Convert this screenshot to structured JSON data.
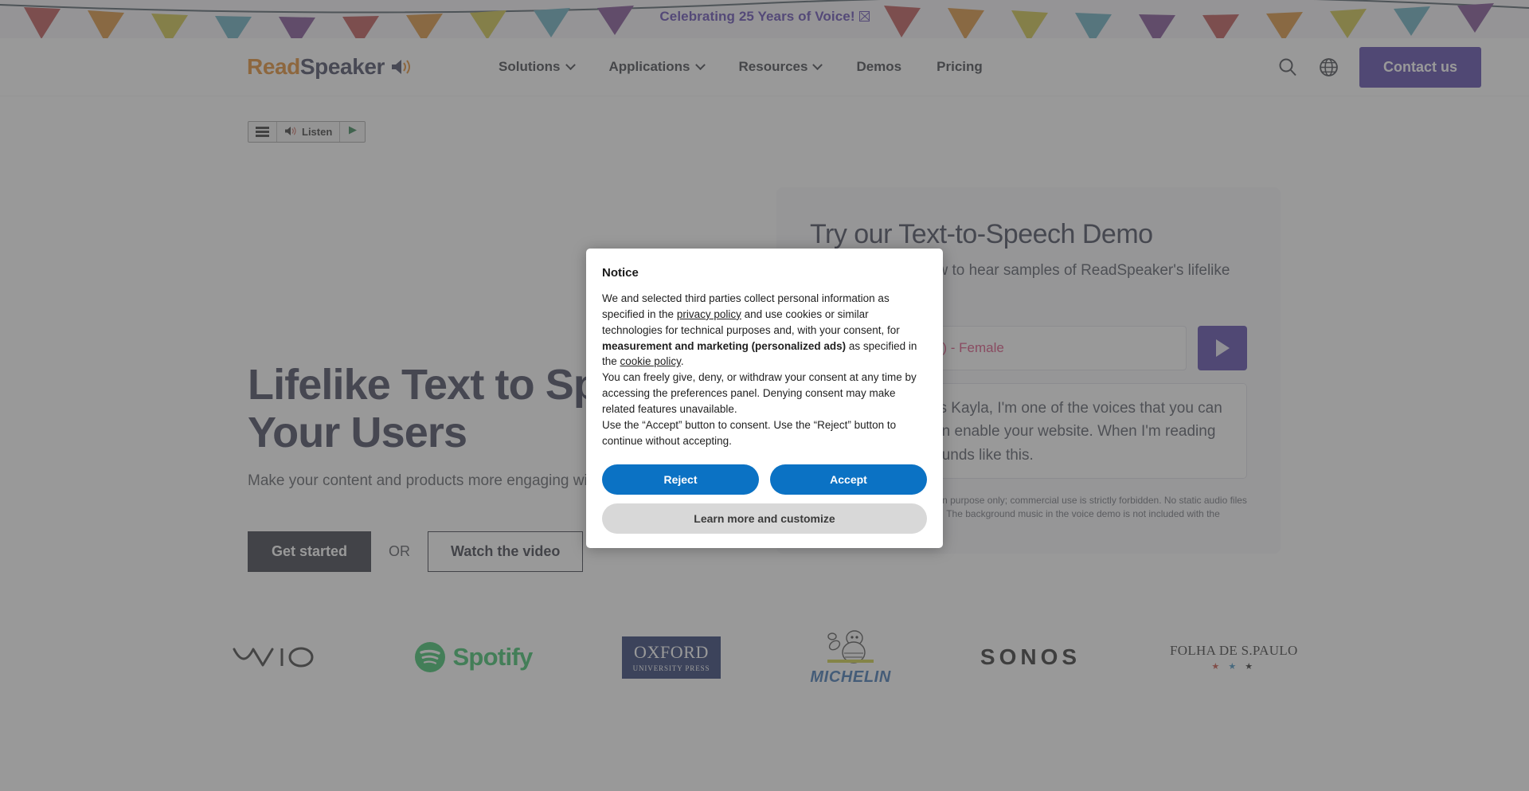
{
  "banner": {
    "text": "Celebrating 25 Years of Voice!",
    "glyph": "tofu-box-glyph"
  },
  "header": {
    "logo": {
      "part1": "Read",
      "part2": "Speaker",
      "icon": "speaker-volume-icon"
    },
    "nav": [
      {
        "label": "Solutions",
        "has_chevron": true
      },
      {
        "label": "Applications",
        "has_chevron": true
      },
      {
        "label": "Resources",
        "has_chevron": true
      },
      {
        "label": "Demos",
        "has_chevron": false
      },
      {
        "label": "Pricing",
        "has_chevron": false
      }
    ],
    "search_icon": "search-icon",
    "language_icon": "globe-icon",
    "contact_label": "Contact us",
    "accent_color": "#3f2a9e"
  },
  "listen_widget": {
    "menu_icon": "hamburger-menu-icon",
    "listen_label": "Listen",
    "speaker_icon": "speaker-icon",
    "play_icon": "play-triangle-icon"
  },
  "hero": {
    "title": "Lifelike Text to Speech for Your Users",
    "subtitle": "Make your content and products more engaging with our text to speech solutions",
    "primary_cta": "Get started",
    "or_label": "OR",
    "secondary_cta": "Watch the video"
  },
  "demo": {
    "title": "Try our Text-to-Speech Demo",
    "subtitle": "Select a voice below to hear samples of ReadSpeaker's lifelike voices",
    "voice_selected": "Kayla - English (US) - Female",
    "play_icon": "play-triangle-icon",
    "sample_text": "Hello! My name is Kayla, I'm one of the voices that you can choose from when enable your website. When I'm reading your content it sounds like this.",
    "note": "The voice demo is for evaluation purpose only; commercial use is strictly forbidden. No static audio files may be created or downloaded. The background music in the voice demo is not included with the purchased voice."
  },
  "clients": [
    {
      "name": "VAIO",
      "text": "\\/\\IO"
    },
    {
      "name": "Spotify",
      "text": "Spotify"
    },
    {
      "name": "Oxford University Press",
      "line1": "OXFORD",
      "line2": "UNIVERSITY PRESS"
    },
    {
      "name": "Michelin",
      "text": "MICHELIN"
    },
    {
      "name": "Sonos",
      "text": "SONOS"
    },
    {
      "name": "Folha de S.Paulo",
      "text": "FOLHA DE S.PAULO",
      "stars": "★ ★ ★"
    }
  ],
  "cookie_modal": {
    "title": "Notice",
    "p1_a": "We and selected third parties collect personal information as specified in the ",
    "p1_link1": "privacy policy",
    "p1_b": " and use cookies or similar technologies for technical purposes and, with your consent, for ",
    "p1_bold": "measurement and marketing (personalized ads)",
    "p1_c": " as specified in the ",
    "p1_link2": "cookie policy",
    "p1_d": ".",
    "p2": "You can freely give, deny, or withdraw your consent at any time by accessing the preferences panel. Denying consent may make related features unavailable.",
    "p3": "Use the “Accept” button to consent. Use the “Reject” button to continue without accepting.",
    "reject_label": "Reject",
    "accept_label": "Accept",
    "learn_more_label": "Learn more and customize",
    "primary_color": "#0b72c4"
  }
}
